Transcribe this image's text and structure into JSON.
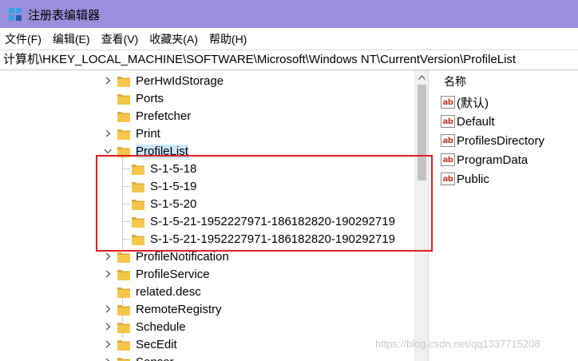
{
  "window": {
    "title": "注册表编辑器",
    "accent_color": "#9a8fdb"
  },
  "menu": {
    "items": [
      "文件(F)",
      "编辑(E)",
      "查看(V)",
      "收藏夹(A)",
      "帮助(H)"
    ]
  },
  "address": {
    "path": "计算机\\HKEY_LOCAL_MACHINE\\SOFTWARE\\Microsoft\\Windows NT\\CurrentVersion\\ProfileList"
  },
  "tree": {
    "items": [
      {
        "label": "PerHwIdStorage",
        "expander": "collapsed"
      },
      {
        "label": "Ports",
        "expander": "none"
      },
      {
        "label": "Prefetcher",
        "expander": "none"
      },
      {
        "label": "Print",
        "expander": "collapsed"
      },
      {
        "label": "ProfileList",
        "expander": "expanded",
        "selected": true
      },
      {
        "label": "S-1-5-18",
        "expander": "none",
        "child": true
      },
      {
        "label": "S-1-5-19",
        "expander": "none",
        "child": true
      },
      {
        "label": "S-1-5-20",
        "expander": "none",
        "child": true
      },
      {
        "label": "S-1-5-21-1952227971-186182820-190292719",
        "expander": "none",
        "child": true
      },
      {
        "label": "S-1-5-21-1952227971-186182820-190292719",
        "expander": "none",
        "child": true
      },
      {
        "label": "ProfileNotification",
        "expander": "collapsed"
      },
      {
        "label": "ProfileService",
        "expander": "collapsed"
      },
      {
        "label": "related.desc",
        "expander": "none"
      },
      {
        "label": "RemoteRegistry",
        "expander": "collapsed"
      },
      {
        "label": "Schedule",
        "expander": "collapsed"
      },
      {
        "label": "SecEdit",
        "expander": "collapsed"
      },
      {
        "label": "Sensor",
        "expander": "collapsed"
      }
    ]
  },
  "values": {
    "column_header": "名称",
    "items": [
      "(默认)",
      "Default",
      "ProfilesDirectory",
      "ProgramData",
      "Public"
    ],
    "icon": "string-value-icon"
  },
  "highlight": {
    "color": "#e02020"
  },
  "watermark": "https://blog.csdn.net/qq1337715208"
}
